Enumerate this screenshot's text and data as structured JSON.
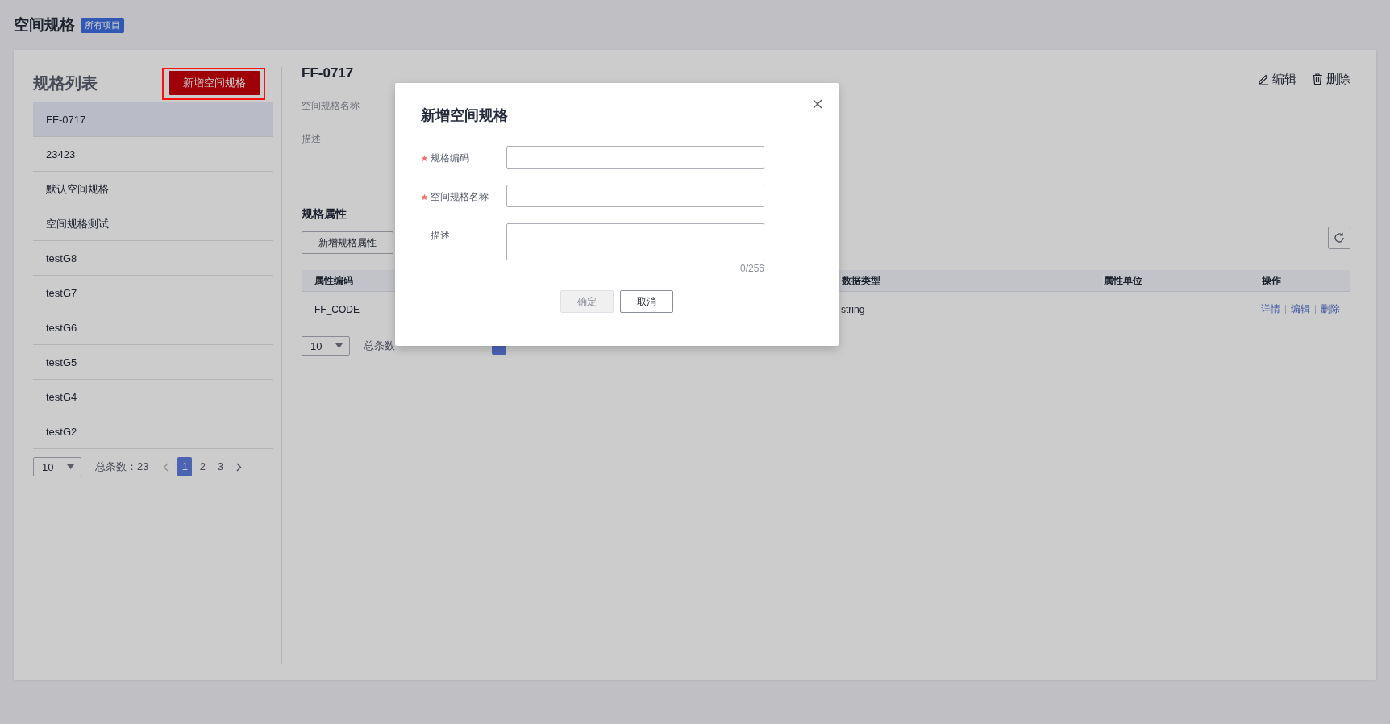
{
  "page": {
    "title": "空间规格",
    "badge": "所有项目"
  },
  "spec_list": {
    "title": "规格列表",
    "add_button": {
      "label": "新增空间规格",
      "highlighted": true
    },
    "items": [
      {
        "label": "FF-0717",
        "selected": true
      },
      {
        "label": "23423",
        "selected": false
      },
      {
        "label": "默认空间规格",
        "selected": false
      },
      {
        "label": "空间规格测试",
        "selected": false
      },
      {
        "label": "testG8",
        "selected": false
      },
      {
        "label": "testG7",
        "selected": false
      },
      {
        "label": "testG6",
        "selected": false
      },
      {
        "label": "testG5",
        "selected": false
      },
      {
        "label": "testG4",
        "selected": false
      },
      {
        "label": "testG2",
        "selected": false
      }
    ],
    "pagination": {
      "page_size": "10",
      "total": "总条数：23",
      "pages": [
        {
          "label": "1",
          "selected": true
        },
        {
          "label": "2",
          "selected": false
        },
        {
          "label": "3",
          "selected": false
        }
      ]
    }
  },
  "detail": {
    "title": "FF-0717",
    "actions": [
      {
        "kind": "edit",
        "label": "编辑"
      },
      {
        "kind": "delete",
        "label": "删除"
      }
    ],
    "fields": [
      "空间规格名称",
      "描述"
    ],
    "section_title": "规格属性",
    "add_button": "新增规格属性",
    "table": {
      "columns": [
        "属性编码",
        "数据类型",
        "属性单位",
        "操作"
      ],
      "rows": [
        {
          "code": "FF_CODE",
          "data_type": "string",
          "actions": [
            "详情",
            "编辑",
            "删除"
          ]
        }
      ]
    },
    "pagination": {
      "page_size": "10",
      "total": "总条数"
    }
  },
  "dialog": {
    "title": "新增空间规格",
    "fields": [
      {
        "kind": "input",
        "label": "规格编码",
        "required": true
      },
      {
        "kind": "input",
        "label": "空间规格名称",
        "required": true
      },
      {
        "kind": "textarea",
        "label": "描述",
        "required": false,
        "counter": "0/256"
      }
    ],
    "buttons": [
      {
        "label": "确定",
        "disabled": true
      },
      {
        "label": "取消",
        "disabled": false
      }
    ]
  }
}
